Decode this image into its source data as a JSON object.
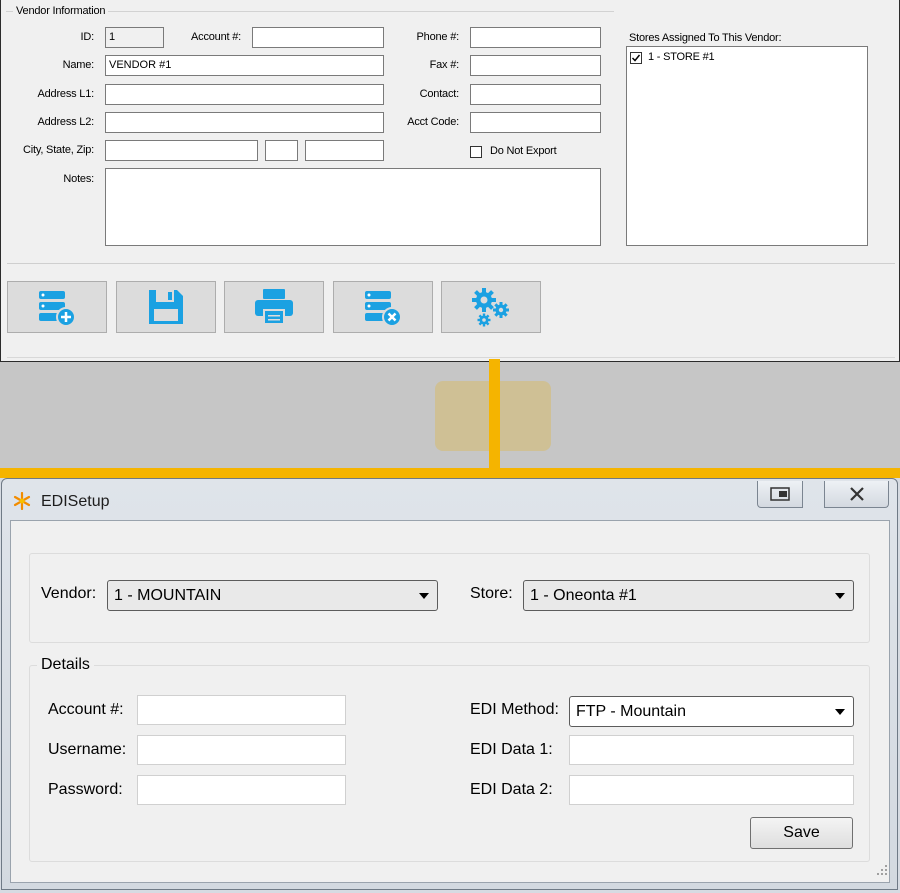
{
  "vendor_form": {
    "group_title": "Vendor Information",
    "id_label": "ID:",
    "id_value": "1",
    "account_label": "Account #:",
    "account_value": "",
    "name_label": "Name:",
    "name_value": "VENDOR #1",
    "address1_label": "Address L1:",
    "address1_value": "",
    "address2_label": "Address L2:",
    "address2_value": "",
    "city_state_zip_label": "City, State, Zip:",
    "city_value": "",
    "state_value": "",
    "zip_value": "",
    "notes_label": "Notes:",
    "notes_value": "",
    "phone_label": "Phone #:",
    "phone_value": "",
    "fax_label": "Fax #:",
    "fax_value": "",
    "contact_label": "Contact:",
    "contact_value": "",
    "acct_code_label": "Acct Code:",
    "acct_code_value": "",
    "do_not_export_label": "Do Not Export",
    "do_not_export_checked": false,
    "stores_label": "Stores Assigned To This Vendor:",
    "stores": [
      {
        "label": "1 - STORE #1",
        "checked": true
      }
    ]
  },
  "toolbar": {
    "icon_color": "#1ba1e2",
    "buttons": [
      {
        "icon": "add-record-icon"
      },
      {
        "icon": "save-icon"
      },
      {
        "icon": "print-icon"
      },
      {
        "icon": "delete-record-icon"
      },
      {
        "icon": "settings-gears-icon"
      }
    ]
  },
  "edi_window": {
    "title": "EDISetup",
    "vendor_label": "Vendor:",
    "vendor_value": "1 - MOUNTAIN",
    "store_label": "Store:",
    "store_value": "1 - Oneonta #1",
    "details_title": "Details",
    "account_label": "Account #:",
    "account_value": "",
    "username_label": "Username:",
    "username_value": "",
    "password_label": "Password:",
    "password_value": "",
    "edi_method_label": "EDI Method:",
    "edi_method_value": "FTP - Mountain",
    "edi_data1_label": "EDI Data 1:",
    "edi_data1_value": "",
    "edi_data2_label": "EDI Data 2:",
    "edi_data2_value": "",
    "save_label": "Save"
  },
  "colors": {
    "highlight": "#f5b400",
    "icon_blue": "#1ba1e2"
  }
}
